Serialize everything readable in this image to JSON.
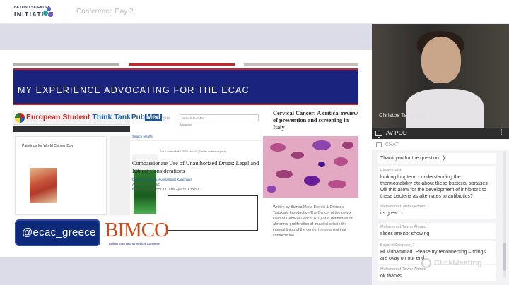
{
  "header": {
    "logo_small": "BEYOND SCIENCES",
    "logo_big": "INITIATIVE",
    "conference_title": "Conference Day 2"
  },
  "slide": {
    "title": "MY EXPERIENCE ADVOCATING FOR THE ECAC",
    "handle": "@ecac_greece",
    "bimco": {
      "name": "BIMCO",
      "subtitle": "Balkan International Medical Congress"
    },
    "est_panel": {
      "site_title_red": "European Student",
      "site_title_blue": "Think Tank",
      "card_title": "Paintings for World Cancer Day"
    },
    "pubmed_panel": {
      "logo_pub": "Pub",
      "logo_med": "Med",
      "logo_gov": ".gov",
      "search_placeholder": "Search PubMed",
      "advanced": "Advanced",
      "search_results": "Search results",
      "meta": "Eur J Intern Med   2019 Nov 16 [Online ahead of print]",
      "article_title": "Compassionate Use of Unauthorized Drugs: Legal and Ethical Considerations",
      "authors": "Christos Tsagkaris, Konstantinos Kalachanis",
      "affiliations": "Affiliations  +  expand",
      "pmid": "PMID: 31733547  DOI: 10.1016/j.ejim.2019.10.015"
    },
    "cervical_panel": {
      "title": "Cervical Cancer: A critical review of prevention and screening in Italy",
      "excerpt": "Written by Bianca Maria Borrelli & Christos Tsagkaris Introduction The Cancer of the cervix Uteri or Cervical Cancer (CC) or is defined as an abnormal proliferation of mutated cells in the internal lining of the cervix, the segment that connects the..."
    }
  },
  "video": {
    "participant_name": "Christos Tsagkaris"
  },
  "av_pod": {
    "label": "AV POD",
    "menu_icon": "more-vertical-icon"
  },
  "chat": {
    "label": "CHAT",
    "messages": [
      {
        "author": "",
        "body": "Thank you for the question. :)"
      },
      {
        "author": "Eleanor Fish",
        "body": "looking longterm - understanding the thermostability etc about these bacterial sortases will this allow for the development of inhibitors to these bacteria as alternates to antibiotics?"
      },
      {
        "author": "Muhammad Tajwar Ahmed",
        "body": "its great...."
      },
      {
        "author": "Muhammad Tajwar Ahmed",
        "body": "slides are not showing"
      },
      {
        "author": "Beyond Sciences_1",
        "body": "Hi Muhammad. Please try reconnecting – things are okay on our end"
      },
      {
        "author": "Muhammad Tajwar Ahmed",
        "body": "ok thanks"
      }
    ]
  },
  "watermark": {
    "text": "ClickMeeting"
  },
  "colors": {
    "title_band": "#1a237e",
    "accent_red": "#c62828",
    "handle_badge": "#0d2a7a",
    "bimco": "#d84315",
    "stage_bg": "#dcdce8"
  }
}
